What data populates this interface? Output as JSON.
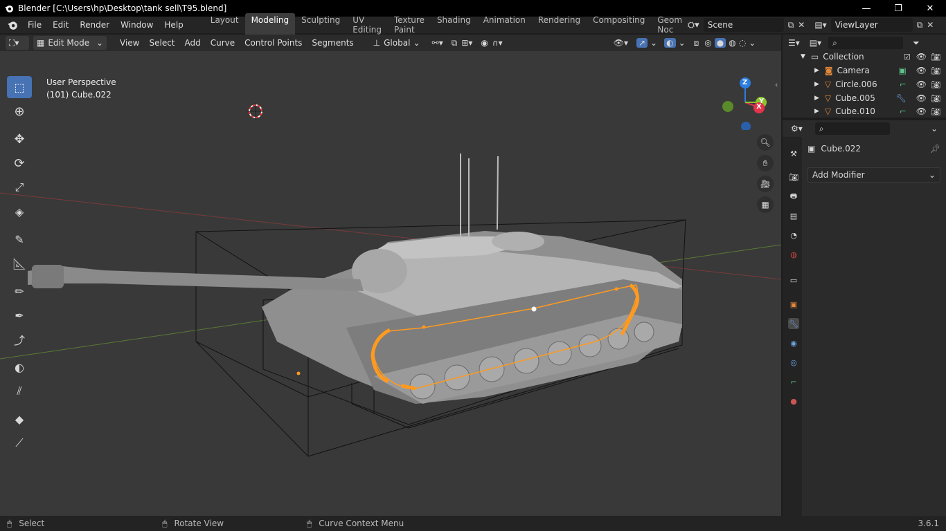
{
  "window": {
    "title": "Blender [C:\\Users\\hp\\Desktop\\tank sell\\T95.blend]",
    "minimize": "—",
    "maximize": "❐",
    "close": "✕"
  },
  "menubar": {
    "items": [
      "File",
      "Edit",
      "Render",
      "Window",
      "Help"
    ],
    "workspaces": [
      "Layout",
      "Modeling",
      "Sculpting",
      "UV Editing",
      "Texture Paint",
      "Shading",
      "Animation",
      "Rendering",
      "Compositing",
      "Geometry Noc"
    ],
    "active_workspace": "Modeling",
    "scene": "Scene",
    "view_layer": "ViewLayer"
  },
  "viewport_header": {
    "mode": "Edit Mode",
    "menus": [
      "View",
      "Select",
      "Add",
      "Curve",
      "Control Points",
      "Segments"
    ],
    "orientation": "Global"
  },
  "viewport": {
    "perspective": "User Perspective",
    "object": "(101) Cube.022",
    "gizmo": {
      "x": "X",
      "y": "Y",
      "z": "Z"
    }
  },
  "outliner": {
    "collection": "Collection",
    "items": [
      "Camera",
      "Circle.006",
      "Cube.005",
      "Cube.010"
    ]
  },
  "properties": {
    "object": "Cube.022",
    "add_modifier": "Add Modifier"
  },
  "statusbar": {
    "select": "Select",
    "rotate": "Rotate View",
    "context": "Curve Context Menu",
    "version": "3.6.1"
  },
  "colors": {
    "accent": "#4772b3",
    "selection": "#ff9a1f",
    "gizmo_x": "#e2344a",
    "gizmo_y": "#8ac52d",
    "gizmo_z": "#2c7de0"
  }
}
